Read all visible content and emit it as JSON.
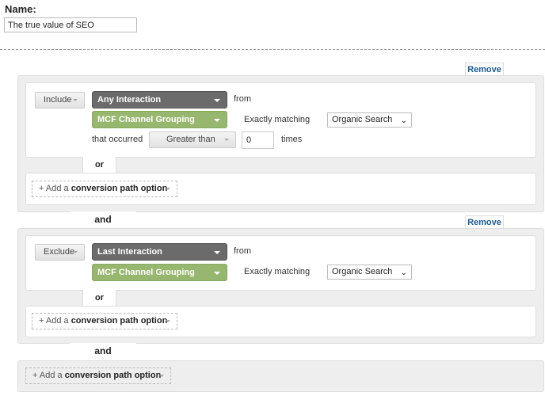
{
  "name_label": "Name:",
  "name_value": "The true value of SEO",
  "remove_label": "Remove",
  "groups": [
    {
      "mode": "Include",
      "interaction": "Any Interaction",
      "from": "from",
      "dimension": "MCF Channel Grouping",
      "match": "Exactly matching",
      "value": "Organic Search",
      "occurred": "that occurred",
      "comparator": "Greater than",
      "count": "0",
      "times": "times"
    },
    {
      "mode": "Exclude",
      "interaction": "Last Interaction",
      "from": "from",
      "dimension": "MCF Channel Grouping",
      "match": "Exactly matching",
      "value": "Organic Search"
    }
  ],
  "or_label": "or",
  "and_label": "and",
  "add_prefix": "+ Add a",
  "add_bold": "conversion path option",
  "colors": {
    "dark_dropdown": "#6b6b6b",
    "green_dropdown": "#97b66e",
    "link": "#1a5a96"
  }
}
